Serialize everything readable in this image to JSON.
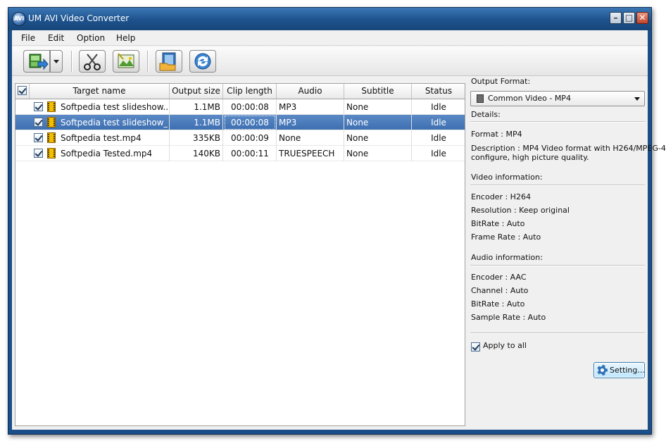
{
  "window": {
    "title": "UM AVI Video Converter",
    "app_icon_text": "AVI",
    "controls": {
      "minimize": "–",
      "maximize": "□",
      "close": "✕"
    }
  },
  "menu": [
    "File",
    "Edit",
    "Option",
    "Help"
  ],
  "toolbar": {
    "buttons": [
      {
        "name": "add-video-button",
        "icon": "add-video-icon"
      },
      {
        "name": "add-dropdown-button",
        "icon": "chevron-down-icon"
      },
      {
        "name": "cut-button",
        "icon": "scissors-icon"
      },
      {
        "name": "effect-button",
        "icon": "effect-icon"
      },
      {
        "name": "output-folder-button",
        "icon": "film-folder-icon"
      },
      {
        "name": "convert-button",
        "icon": "refresh-icon"
      }
    ]
  },
  "table": {
    "columns": [
      "Target name",
      "Output size",
      "Clip length",
      "Audio",
      "Subtitle",
      "Status"
    ],
    "rows": [
      {
        "name": "Softpedia test slideshow....",
        "size": "1.1MB",
        "length": "00:00:08",
        "audio": "MP3",
        "subtitle": "None",
        "status": "Idle",
        "checked": true,
        "selected": false
      },
      {
        "name": "Softpedia test slideshow_...",
        "size": "1.1MB",
        "length": "00:00:08",
        "audio": "MP3",
        "subtitle": "None",
        "status": "Idle",
        "checked": true,
        "selected": true
      },
      {
        "name": "Softpedia test.mp4",
        "size": "335KB",
        "length": "00:00:09",
        "audio": "None",
        "subtitle": "None",
        "status": "Idle",
        "checked": true,
        "selected": false
      },
      {
        "name": "Softpedia Tested.mp4",
        "size": "140KB",
        "length": "00:00:11",
        "audio": "TRUESPEECH",
        "subtitle": "None",
        "status": "Idle",
        "checked": true,
        "selected": false
      }
    ]
  },
  "panel": {
    "output_format_label": "Output Format:",
    "output_format_value": "Common Video - MP4",
    "details_label": "Details:",
    "format_line": "Format     : MP4",
    "description_line1": "Description : MP4 Video format with H264/MPEG-4",
    "description_line2": "configure, high picture quality.",
    "video_info_label": "Video information:",
    "video": {
      "encoder": "Encoder     : H264",
      "resolution": "Resolution  : Keep original",
      "bitrate": "BitRate     : Auto",
      "framerate": "Frame Rate  : Auto"
    },
    "audio_info_label": "Audio information:",
    "audio": {
      "encoder": "Encoder     : AAC",
      "channel": "Channel     : Auto",
      "bitrate": "BitRate     : Auto",
      "samplerate": "Sample Rate : Auto"
    },
    "apply_all_label": "Apply to all",
    "setting_button": "Setting..."
  },
  "colors": {
    "selection": "#3e6fb0",
    "titlebar": "#1d528d"
  }
}
